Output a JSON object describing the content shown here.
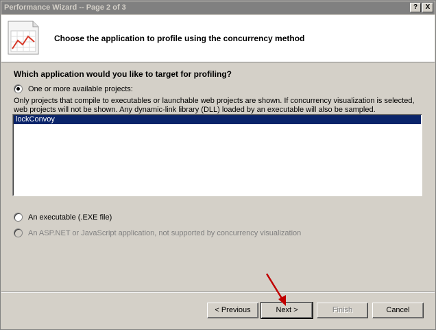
{
  "window": {
    "title": "Performance Wizard -- Page 2 of 3",
    "help_btn": "?",
    "close_btn": "X"
  },
  "header": {
    "heading": "Choose the application to profile using the concurrency method",
    "icon": "chart-wizard-icon"
  },
  "main": {
    "question": "Which application would you like to target for profiling?",
    "options": [
      {
        "label": "One or more available projects:",
        "checked": true,
        "disabled": false
      },
      {
        "label": "An executable (.EXE file)",
        "checked": false,
        "disabled": false
      },
      {
        "label": "An ASP.NET or JavaScript application, not supported by concurrency visualization",
        "checked": false,
        "disabled": true
      }
    ],
    "note_line1": "Only projects that compile to executables or launchable web projects are shown. If concurrency visualization is selected,",
    "note_line2": "web projects will not be shown. Any dynamic-link library (DLL) loaded by an executable will also be sampled.",
    "projects": [
      {
        "name": "lockConvoy",
        "selected": true
      }
    ]
  },
  "buttons": {
    "previous": "< Previous",
    "next": "Next >",
    "finish": "Finish",
    "cancel": "Cancel"
  },
  "colors": {
    "selection": "#0a246a",
    "arrow": "#c00000"
  }
}
